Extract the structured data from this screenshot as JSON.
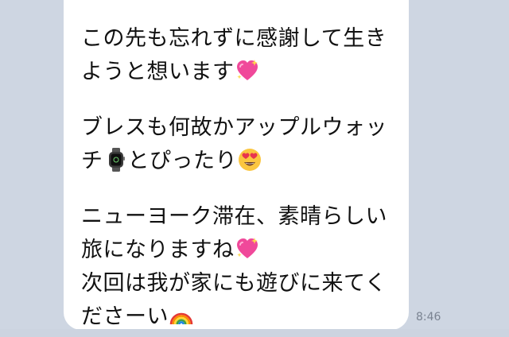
{
  "message": {
    "paragraphs": [
      {
        "lines": [
          {
            "text": "この先も忘れずに感謝して生き"
          },
          {
            "text": "ようと想います",
            "emoji": "sparkling-heart"
          }
        ]
      },
      {
        "lines": [
          {
            "text": "ブレスも何故かアップルウォッ"
          },
          {
            "text": "チ",
            "emoji": "watch",
            "text_after": "とぴったり",
            "emoji_after": "heart-eyes-face"
          }
        ]
      },
      {
        "lines": [
          {
            "text": "ニューヨーク滞在、素晴らしい"
          },
          {
            "text": "旅になりますね",
            "emoji": "sparkling-heart"
          },
          {
            "text": "次回は我が家にも遊びに来てく"
          },
          {
            "text": "ださーい",
            "emoji": "rainbow"
          }
        ]
      }
    ],
    "timestamp": "8:46"
  },
  "colors": {
    "chat_background": "#ced6e2",
    "bubble": "#ffffff",
    "text": "#111111",
    "timestamp": "#7a8391"
  }
}
